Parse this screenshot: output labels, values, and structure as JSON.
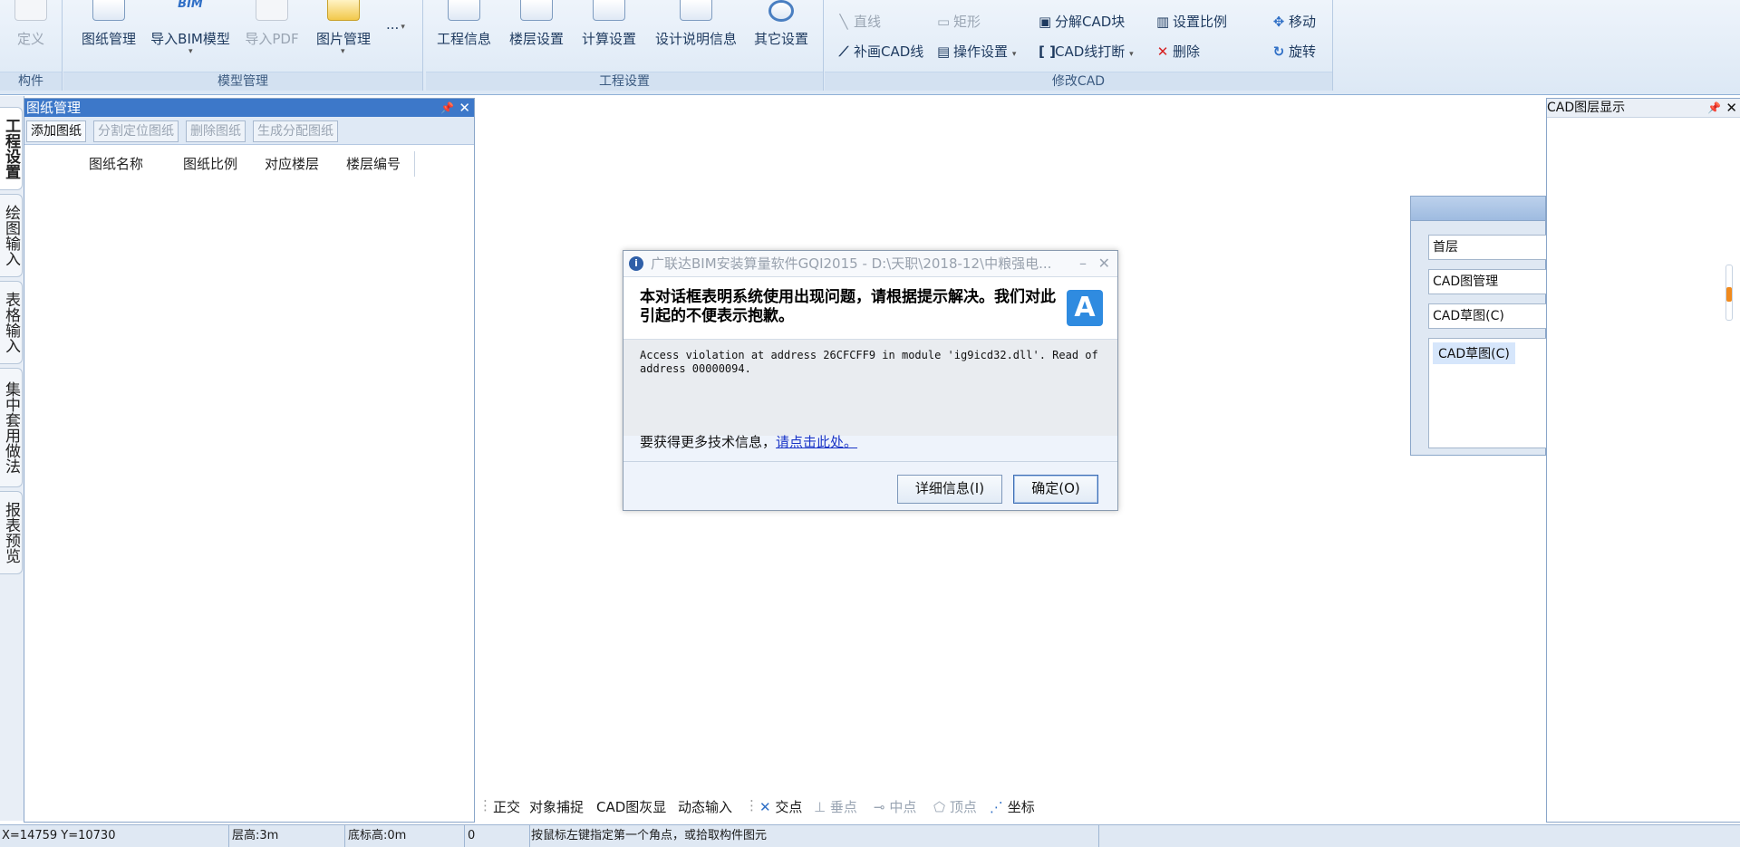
{
  "ribbon": {
    "groups": [
      {
        "label": "构件"
      },
      {
        "label": "模型管理"
      },
      {
        "label": "工程设置"
      },
      {
        "label": "修改CAD"
      }
    ],
    "goujian": {
      "define": "定义"
    },
    "model": {
      "drawing_mgmt": "图纸管理",
      "import_bim": "导入BIM模型",
      "import_bim_sub": "BIM",
      "import_pdf": "导入PDF",
      "image_mgmt": "图片管理",
      "more": "..."
    },
    "project": {
      "project_info": "工程信息",
      "floor_settings": "楼层设置",
      "calc_settings": "计算设置",
      "design_notes": "设计说明信息",
      "other_settings": "其它设置"
    },
    "modify_cad": {
      "line": "直线",
      "rect": "矩形",
      "explode_cad_block": "分解CAD块",
      "set_scale": "设置比例",
      "move": "移动",
      "draw_cad_line": "补画CAD线",
      "op_settings": "操作设置",
      "break_cad_line": "CAD线打断",
      "delete": "删除",
      "rotate": "旋转"
    }
  },
  "vtabs": [
    "工程设置",
    "绘图输入",
    "表格输入",
    "集中套用做法",
    "报表预览"
  ],
  "drawing_panel": {
    "title": "图纸管理",
    "toolbar": [
      "添加图纸",
      "分割定位图纸",
      "删除图纸",
      "生成分配图纸"
    ],
    "columns": [
      "",
      "图纸名称",
      "图纸比例",
      "对应楼层",
      "楼层编号"
    ]
  },
  "dialog": {
    "title": "广联达BIM安装算量软件GQI2015 - D:\\天职\\2018-12\\中粮强电...",
    "header": "本对话框表明系统使用出现问题，请根据提示解决。我们对此引起的不便表示抱歉。",
    "logo": "A",
    "error": "Access violation at address 26CFCFF9 in module 'ig9icd32.dll'. Read of address 00000094.",
    "more_prefix": "要获得更多技术信息，",
    "more_link": "请点击此处。",
    "btn_details": "详细信息(I)",
    "btn_ok": "确定(O)"
  },
  "snap_bar": {
    "ortho": "正交",
    "osnap": "对象捕捉",
    "cad_gray": "CAD图灰显",
    "dyn_input": "动态输入",
    "intersection": "交点",
    "perpendicular": "垂点",
    "midpoint": "中点",
    "vertex": "顶点",
    "coordinate": "坐标"
  },
  "layer_panel": {
    "title": "CAD图层显示"
  },
  "float_panel": {
    "floor": "首层",
    "cad_mgmt": "CAD图管理",
    "cad_sketch": "CAD草图(C)",
    "list_selected": "CAD草图(C)"
  },
  "status_bar": {
    "coords": "X=14759 Y=10730",
    "floor_height": "层高:3m",
    "base_height": "底标高:0m",
    "value": "0",
    "hint": "按鼠标左键指定第一个角点，或拾取构件图元"
  }
}
